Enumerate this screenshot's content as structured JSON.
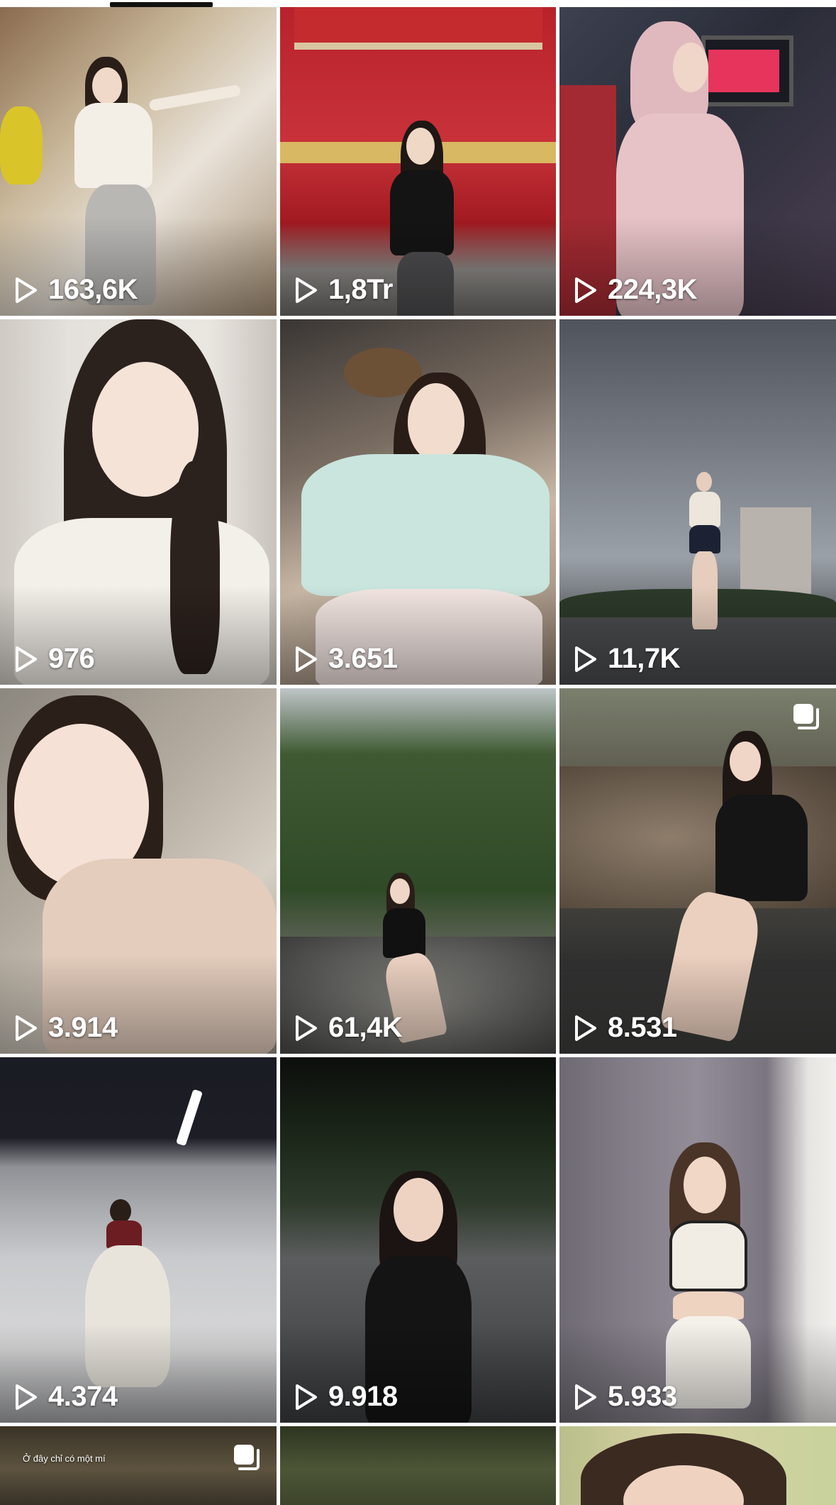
{
  "videos": [
    {
      "views": "163,6K"
    },
    {
      "views": "1,8Tr"
    },
    {
      "views": "224,3K"
    },
    {
      "views": "976"
    },
    {
      "views": "3.651"
    },
    {
      "views": "11,7K"
    },
    {
      "views": "3.914"
    },
    {
      "views": "61,4K"
    },
    {
      "views": "8.531"
    },
    {
      "views": "4.374"
    },
    {
      "views": "9.918"
    },
    {
      "views": "5.933"
    },
    {
      "views": ""
    },
    {
      "views": ""
    },
    {
      "views": ""
    }
  ],
  "partial_row": {
    "caption": "Ở đây chỉ có một mí"
  },
  "icons": {
    "play": "play-icon",
    "multi_photo": "multi-photo-icon"
  },
  "colors": {
    "background": "#ffffff",
    "overlay_text": "#ffffff",
    "tab_indicator": "#111111"
  }
}
